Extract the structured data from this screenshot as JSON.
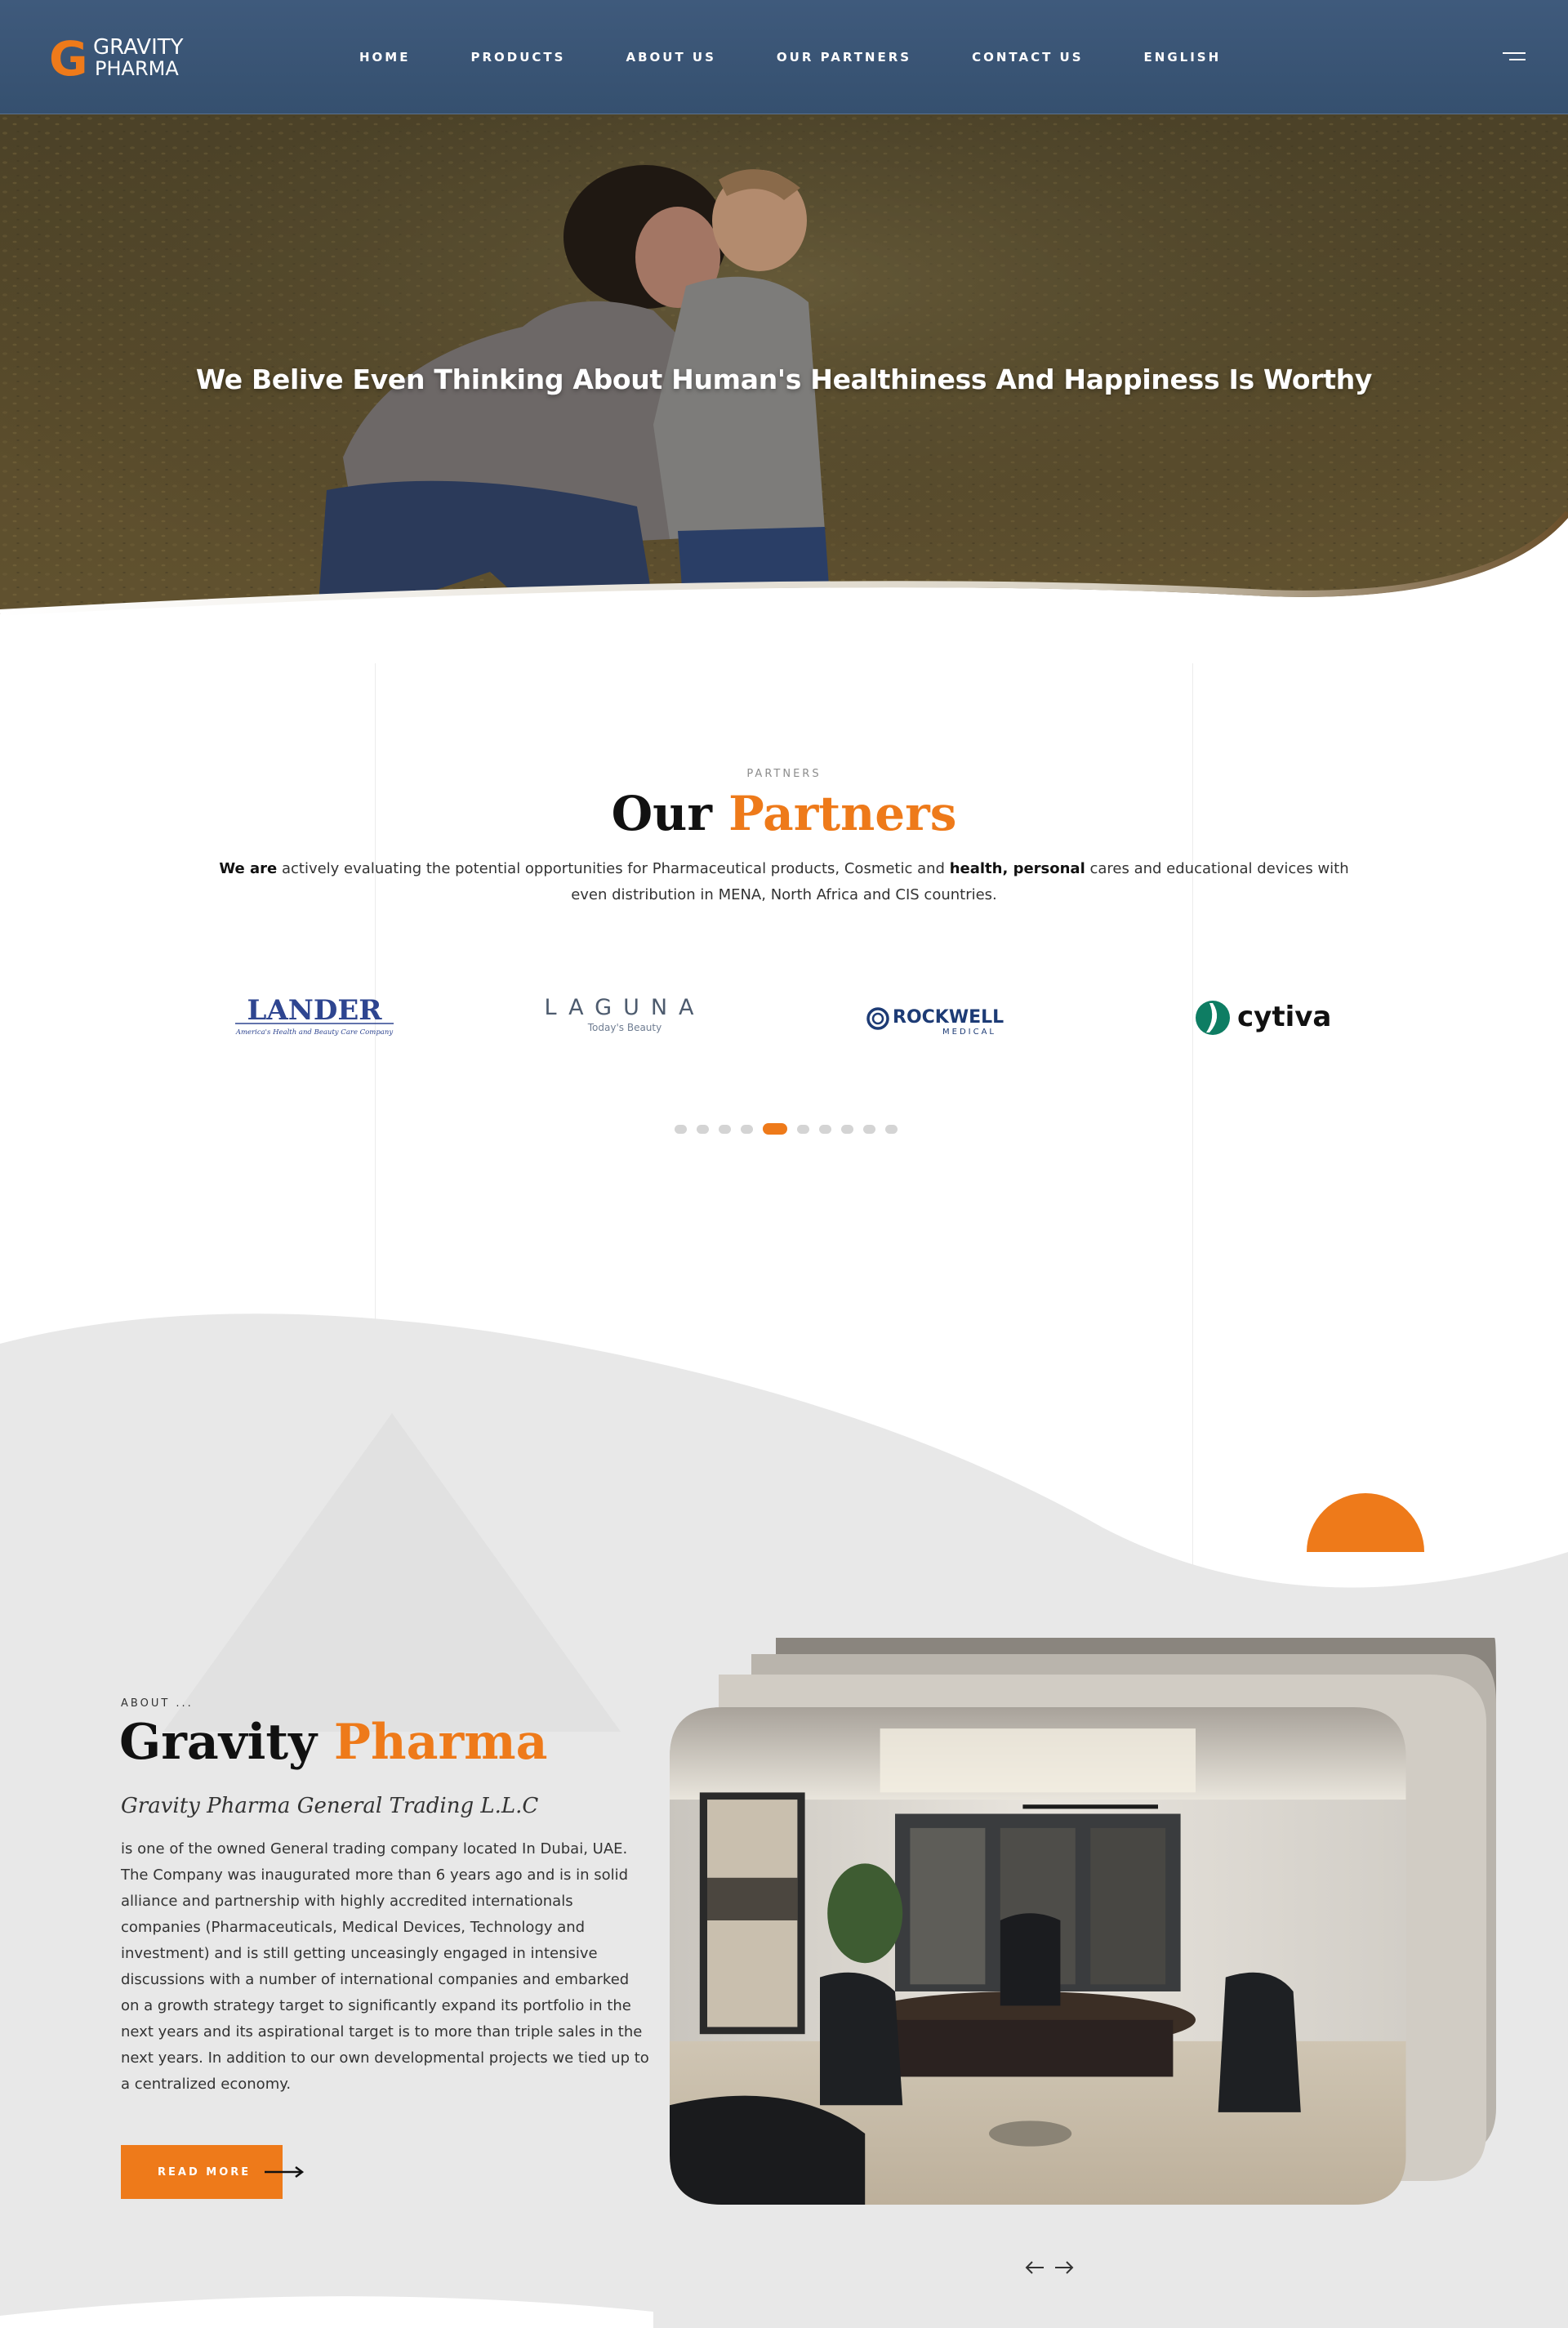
{
  "header": {
    "logo": {
      "line1": "GRAVITY",
      "line2": "PHARMA",
      "mark": "G"
    },
    "nav": [
      "HOME",
      "PRODUCTS",
      "ABOUT US",
      "OUR PARTNERS",
      "CONTACT US",
      "ENGLISH"
    ],
    "menu_icon": "hamburger-icon"
  },
  "hero": {
    "title": "We Belive Even Thinking About Human's Healthiness And Happiness Is Worthy"
  },
  "partners": {
    "eyebrow": "PARTNERS",
    "title_main": "Our",
    "title_accent": "Partners",
    "desc_bold1": "We are",
    "desc_part1": " actively evaluating the potential opportunities for Pharmaceutical products, Cosmetic and ",
    "desc_bold2": "health, personal",
    "desc_part2": " cares and educational devices with even distribution in MENA, North Africa and CIS countries.",
    "logos": [
      {
        "name": "LANDER",
        "tagline": "America's Health and Beauty Care Company"
      },
      {
        "name": "LAGUNA",
        "tagline": "Today's Beauty"
      },
      {
        "name": "ROCKWELL",
        "tagline": "MEDICAL"
      },
      {
        "name": "cytiva",
        "tagline": ""
      }
    ],
    "carousel_dots": 10,
    "active_dot": 5
  },
  "about": {
    "eyebrow": "ABOUT ...",
    "title_main": "Gravity",
    "title_accent": "Pharma",
    "subtitle": "Gravity Pharma General Trading L.L.C",
    "body": "is one of the owned General trading company located In Dubai, UAE. The Company was inaugurated more than 6 years ago and is in solid alliance and partnership with highly accredited internationals companies (Pharmaceuticals, Medical Devices, Technology and investment) and is still getting unceasingly engaged in intensive discussions with a number of international companies and embarked on a growth strategy target to significantly expand its portfolio in the next years and its aspirational target is to more than triple sales in the next years. In addition to our own developmental projects we tied up to a centralized economy.",
    "read_more": "READ MORE",
    "prev_icon": "arrow-left-icon",
    "next_icon": "arrow-right-icon"
  },
  "colors": {
    "accent": "#ee7a1a",
    "header_bg": "#3f5a7c",
    "section_bg": "#e8e8e8"
  }
}
